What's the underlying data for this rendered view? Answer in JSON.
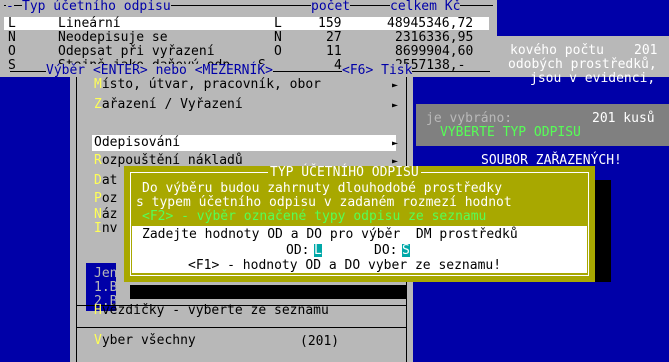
{
  "list_panel": {
    "header": {
      "col_type": "Typ účetního odpisu",
      "col_count": "počet",
      "col_total": "celkem Kč"
    },
    "rows": [
      {
        "code": "L",
        "name": "Lineární",
        "code2": "L",
        "count": "159",
        "total": "48945346,72",
        "selected": true
      },
      {
        "code": "N",
        "name": "Neodepisuje se",
        "code2": "N",
        "count": "27",
        "total": "2316336,95",
        "selected": false
      },
      {
        "code": "O",
        "name": "Odepsat při vyřazení",
        "code2": "O",
        "count": "11",
        "total": "8699904,60",
        "selected": false
      },
      {
        "code": "S",
        "name": "Stejně jako daňový odp.",
        "code2": "S",
        "count": "4",
        "total": "2557138,-",
        "selected": false
      }
    ],
    "footer": "Výběr <ENTER> nebo <MEZERNÍK>",
    "footer_f6": "<F6> Tisk"
  },
  "right_panel": {
    "line1a": "kového počtu",
    "line1b": "201",
    "line2": "odobých prostředků,",
    "line3": "jsou v evidenci,",
    "selected_label": "je vybráno:",
    "selected_value": "201 kusů",
    "hint": "VYBERTE TYP ODPISU",
    "file_label": "SOUBOR ZAŘAZENÝCH!"
  },
  "menu": {
    "items": [
      {
        "hot": "M",
        "rest": "ísto, útvar, pracovník, obor",
        "arrow": true
      },
      {
        "hot": "Z",
        "rest": "ařazení / Vyřazení",
        "arrow": true
      },
      {
        "hot": "O",
        "rest": "depisování",
        "arrow": true,
        "selected": true
      },
      {
        "hot": "R",
        "rest": "ozpouštění nákladů",
        "arrow": true
      },
      {
        "hot": "D",
        "rest": "at",
        "arrow": false
      },
      {
        "hot": "P",
        "rest": "oz",
        "arrow": false
      },
      {
        "hot": "N",
        "rest": "áz",
        "arrow": false
      },
      {
        "hot": "I",
        "rest": "nv",
        "arrow": false
      }
    ],
    "sub1": "Jen",
    "sub2": "1.B",
    "sub3": "2.B",
    "stars_hot": "H",
    "stars_rest": "vězdičky - vyberte ze seznamu",
    "all_hot": "V",
    "all_rest": "yber všechny",
    "all_count": "(201)"
  },
  "dialog": {
    "title": "TYP ÚČETNÍHO ODPISU",
    "line1": "Do výběru budou zahrnuty dlouhodobé prostředky",
    "line2": "s typem účetního odpisu v zadaném rozmezí hodnot",
    "line3": "<F2> - výběr označené typy odpisu ze seznamu",
    "prompt": "Zadejte hodnoty OD a DO pro výběr  DM prostředků",
    "from_label": "OD:",
    "from_value": "L",
    "to_label": "DO:",
    "to_value": "S",
    "hint": "<F1> - hodnoty OD a DO vyber ze seznamu!"
  }
}
